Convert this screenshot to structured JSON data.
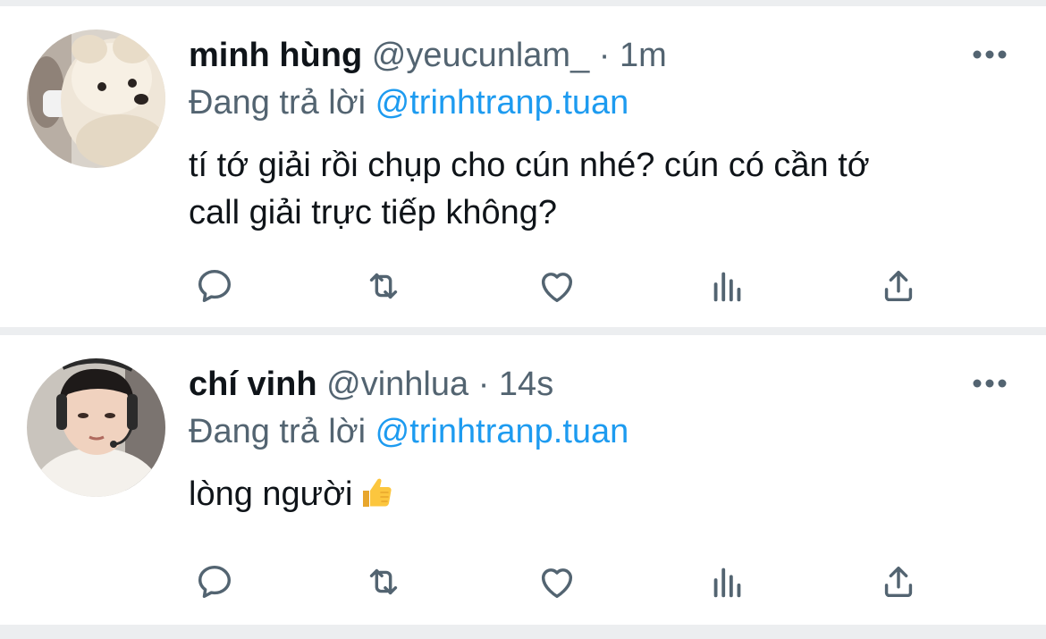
{
  "tweets": [
    {
      "name": "minh hùng",
      "handle": "@yeucunlam_",
      "separator": "·",
      "time": "1m",
      "replying_prefix": "Đang trả lời",
      "replying_to": "@trinhtranp.tuan",
      "text_line1": "tí tớ giải rồi chụp cho cún nhé? cún có cần tớ",
      "text_line2": "call giải trực tiếp không?"
    },
    {
      "name": "chí vinh",
      "handle": "@vinhlua",
      "separator": "·",
      "time": "14s",
      "replying_prefix": "Đang trả lời",
      "replying_to": "@trinhtranp.tuan",
      "text_line1": "lòng người",
      "emoji": "thumbs-up"
    }
  ],
  "colors": {
    "primary_text": "#0f1419",
    "secondary_text": "#536471",
    "accent": "#1d9bf0",
    "divider": "#eceef0"
  },
  "icons": [
    "reply-icon",
    "retweet-icon",
    "like-icon",
    "views-icon",
    "share-icon",
    "more-icon"
  ]
}
